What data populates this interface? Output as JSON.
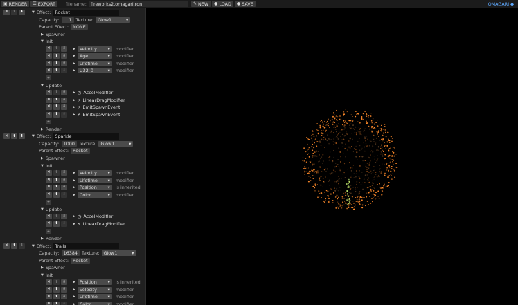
{
  "toolbar": {
    "render_label": "RENDER",
    "export_label": "EXPORT",
    "filename_label": "filename:",
    "filename_value": "fireworks2.omagari.ron",
    "new_label": "NEW",
    "load_label": "LOAD",
    "save_label": "SAVE",
    "brand": "OMAGARI"
  },
  "effects": [
    {
      "effect_label": "Effect:",
      "name": "Rocket",
      "capacity_label": "Capacity:",
      "capacity": "1",
      "texture_label": "Texture:",
      "texture": "Glow1",
      "parent_label": "Parent Effect:",
      "parent": "NONE",
      "spawner": "Spawner",
      "init": "Init",
      "init_rows": [
        {
          "attr": "Velocity",
          "mode": "modifier"
        },
        {
          "attr": "Age",
          "mode": "modifier"
        },
        {
          "attr": "Lifetime",
          "mode": "modifier"
        },
        {
          "attr": "U32_0",
          "mode": "modifier"
        }
      ],
      "update": "Update",
      "update_rows": [
        {
          "icon": "clock-icon",
          "name": "AccelModifier"
        },
        {
          "icon": "bolt-icon",
          "name": "LinearDragModifier"
        },
        {
          "icon": "bolt-icon",
          "name": "EmitSpawnEvent"
        },
        {
          "icon": "bolt-icon",
          "name": "EmitSpawnEvent"
        }
      ],
      "render": "Render"
    },
    {
      "effect_label": "Effect:",
      "name": "Sparkle",
      "capacity_label": "Capacity:",
      "capacity": "1000",
      "texture_label": "Texture:",
      "texture": "Glow1",
      "parent_label": "Parent Effect:",
      "parent": "Rocket",
      "spawner": "Spawner",
      "init": "Init",
      "init_rows": [
        {
          "attr": "Velocity",
          "mode": "modifier"
        },
        {
          "attr": "Lifetime",
          "mode": "modifier"
        },
        {
          "attr": "Position",
          "mode": "is inherited"
        },
        {
          "attr": "Color",
          "mode": "modifier"
        }
      ],
      "update": "Update",
      "update_rows": [
        {
          "icon": "clock-icon",
          "name": "AccelModifier"
        },
        {
          "icon": "bolt-icon",
          "name": "LinearDragModifier"
        }
      ],
      "render": "Render"
    },
    {
      "effect_label": "Effect:",
      "name": "Trails",
      "capacity_label": "Capacity:",
      "capacity": "16384",
      "texture_label": "Texture:",
      "texture": "Glow1",
      "parent_label": "Parent Effect:",
      "parent": "Rocket",
      "spawner": "Spawner",
      "init": "Init",
      "init_rows": [
        {
          "attr": "Position",
          "mode": "is inherited"
        },
        {
          "attr": "Velocity",
          "mode": "modifier"
        },
        {
          "attr": "Lifetime",
          "mode": "modifier"
        },
        {
          "attr": "Color",
          "mode": "modifier"
        }
      ]
    }
  ],
  "colors": {
    "accent": "#5ea9ff",
    "panel": "#212121",
    "spark_orange": "#ff8a2a",
    "spark_green": "#b8e06a"
  }
}
